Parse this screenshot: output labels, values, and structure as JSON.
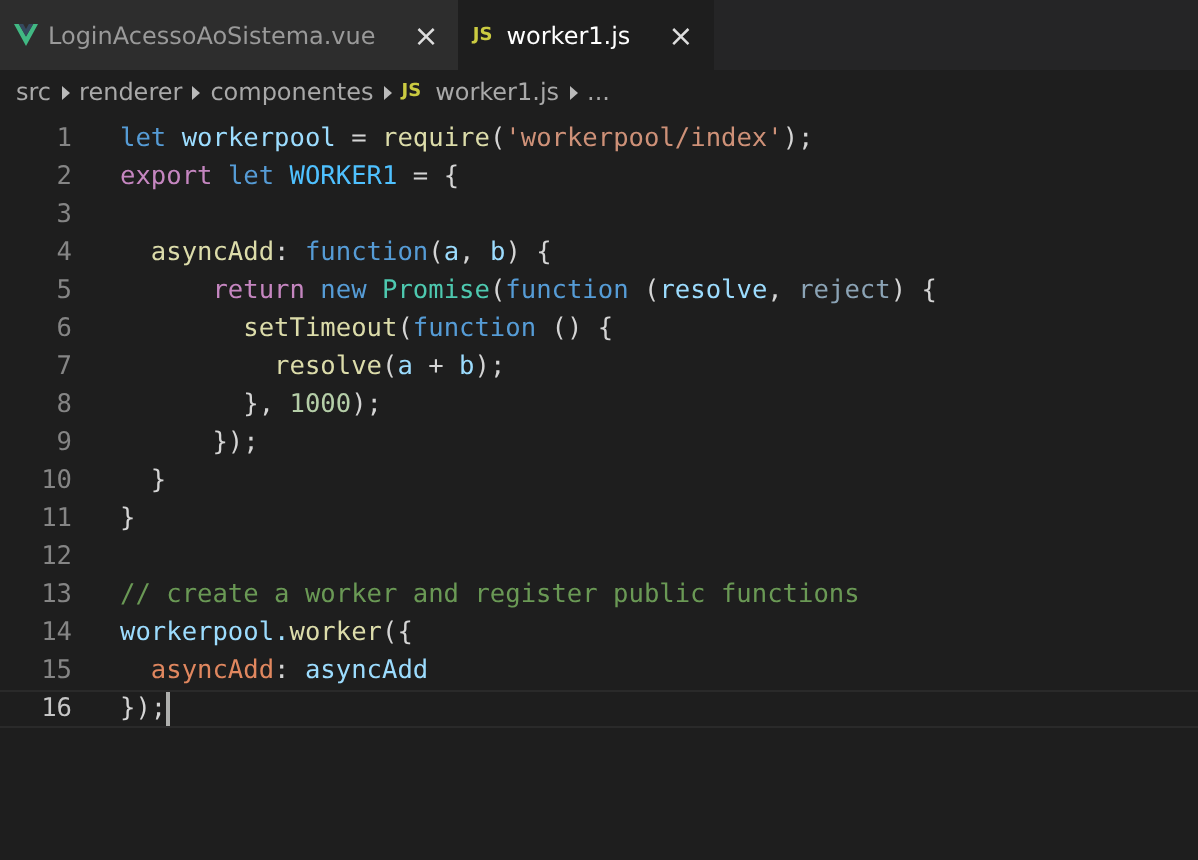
{
  "tabs": [
    {
      "label": "LoginAcessoAoSistema.vue",
      "kind": "vue",
      "selected": false,
      "close": "×"
    },
    {
      "label": "worker1.js",
      "kind": "js",
      "badge": "JS",
      "selected": true,
      "close": "×"
    }
  ],
  "breadcrumb": [
    {
      "text": "src",
      "kind": "folder"
    },
    {
      "text": "renderer",
      "kind": "folder"
    },
    {
      "text": "componentes",
      "kind": "folder"
    },
    {
      "text": "worker1.js",
      "kind": "file",
      "badge": "JS"
    },
    {
      "text": "...",
      "kind": "more"
    }
  ],
  "lines": [
    {
      "number": "1",
      "current": false,
      "tokens": [
        {
          "text": "let ",
          "kind": "keyword"
        },
        {
          "text": "workerpool",
          "kind": "variable"
        },
        {
          "text": " = ",
          "kind": "plain"
        },
        {
          "text": "require",
          "kind": "function"
        },
        {
          "text": "(",
          "kind": "plain"
        },
        {
          "text": "'workerpool/index'",
          "kind": "string"
        },
        {
          "text": ");",
          "kind": "plain"
        }
      ]
    },
    {
      "number": "2",
      "current": false,
      "tokens": [
        {
          "text": "export ",
          "kind": "control"
        },
        {
          "text": "let ",
          "kind": "keyword"
        },
        {
          "text": "WORKER1",
          "kind": "constant"
        },
        {
          "text": " = {",
          "kind": "plain"
        }
      ]
    },
    {
      "number": "3",
      "current": false
    },
    {
      "number": "4",
      "current": false,
      "tokens": [
        {
          "text": "  asyncAdd",
          "kind": "function"
        },
        {
          "text": ": ",
          "kind": "plain"
        },
        {
          "text": "function",
          "kind": "keyword"
        },
        {
          "text": "(",
          "kind": "plain"
        },
        {
          "text": "a",
          "kind": "variable"
        },
        {
          "text": ", ",
          "kind": "plain"
        },
        {
          "text": "b",
          "kind": "variable"
        },
        {
          "text": ") {",
          "kind": "plain"
        }
      ]
    },
    {
      "number": "5",
      "current": false,
      "tokens": [
        {
          "text": "      return ",
          "kind": "control"
        },
        {
          "text": "new ",
          "kind": "keyword"
        },
        {
          "text": "Promise",
          "kind": "class"
        },
        {
          "text": "(",
          "kind": "plain"
        },
        {
          "text": "function ",
          "kind": "keyword"
        },
        {
          "text": "(",
          "kind": "plain"
        },
        {
          "text": "resolve",
          "kind": "variable"
        },
        {
          "text": ", ",
          "kind": "plain"
        },
        {
          "text": "reject",
          "kind": "unused"
        },
        {
          "text": ") {",
          "kind": "plain"
        }
      ]
    },
    {
      "number": "6",
      "current": false,
      "tokens": [
        {
          "text": "        setTimeout",
          "kind": "function"
        },
        {
          "text": "(",
          "kind": "plain"
        },
        {
          "text": "function ",
          "kind": "keyword"
        },
        {
          "text": "() {",
          "kind": "plain"
        }
      ]
    },
    {
      "number": "7",
      "current": false,
      "tokens": [
        {
          "text": "          resolve",
          "kind": "function"
        },
        {
          "text": "(",
          "kind": "plain"
        },
        {
          "text": "a",
          "kind": "variable"
        },
        {
          "text": " + ",
          "kind": "plain"
        },
        {
          "text": "b",
          "kind": "variable"
        },
        {
          "text": ");",
          "kind": "plain"
        }
      ]
    },
    {
      "number": "8",
      "current": false,
      "tokens": [
        {
          "text": "        }, ",
          "kind": "plain"
        },
        {
          "text": "1000",
          "kind": "number"
        },
        {
          "text": ");",
          "kind": "plain"
        }
      ]
    },
    {
      "number": "9",
      "current": false,
      "tokens": [
        {
          "text": "      });",
          "kind": "plain"
        }
      ]
    },
    {
      "number": "10",
      "current": false,
      "tokens": [
        {
          "text": "  }",
          "kind": "plain"
        }
      ]
    },
    {
      "number": "11",
      "current": false,
      "tokens": [
        {
          "text": "}",
          "kind": "plain"
        }
      ]
    },
    {
      "number": "12",
      "current": false
    },
    {
      "number": "13",
      "current": false,
      "tokens": [
        {
          "text": "// create a worker and register public functions",
          "kind": "comment"
        }
      ]
    },
    {
      "number": "14",
      "current": false,
      "tokens": [
        {
          "text": "workerpool.",
          "kind": "variable"
        },
        {
          "text": "worker",
          "kind": "function"
        },
        {
          "text": "({",
          "kind": "plain"
        }
      ]
    },
    {
      "number": "15",
      "current": false,
      "tokens": [
        {
          "text": "  asyncAdd",
          "kind": "property"
        },
        {
          "text": ": ",
          "kind": "plain"
        },
        {
          "text": "asyncAdd",
          "kind": "variable"
        }
      ]
    },
    {
      "number": "16",
      "current": true,
      "tokens": [
        {
          "text": "});",
          "kind": "plain"
        }
      ]
    }
  ]
}
